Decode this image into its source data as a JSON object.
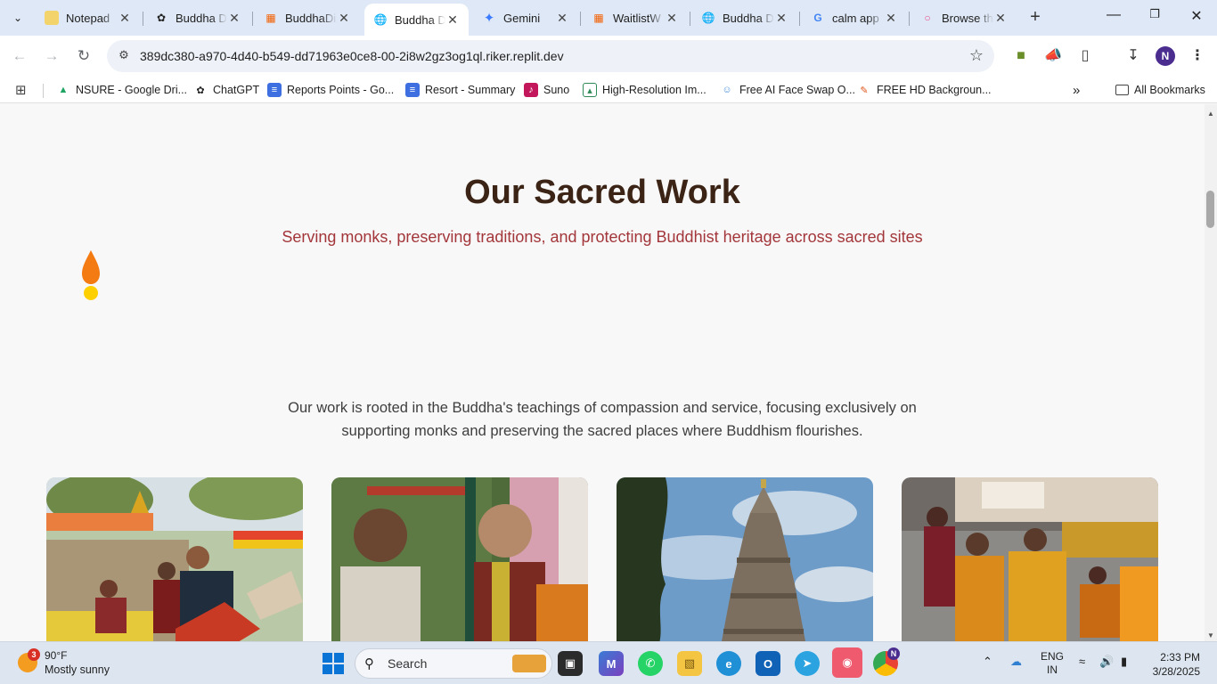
{
  "tabs": [
    {
      "title": "Notepad",
      "favicon": "notepad-icon",
      "color": "#f3d36b"
    },
    {
      "title": "Buddha D",
      "favicon": "openai-icon",
      "color": "#222222"
    },
    {
      "title": "BuddhaDi",
      "favicon": "replit-icon",
      "color": "#f26207"
    },
    {
      "title": "Buddha D",
      "favicon": "globe-icon",
      "color": "#5f6368"
    },
    {
      "title": "Gemini",
      "favicon": "gemini-icon",
      "color": "#3b7bff"
    },
    {
      "title": "WaitlistW",
      "favicon": "replit-icon",
      "color": "#f26207"
    },
    {
      "title": "Buddha D",
      "favicon": "globe-icon",
      "color": "#5f6368"
    },
    {
      "title": "calm app",
      "favicon": "google-icon",
      "color": "#4285f4"
    },
    {
      "title": "Browse th",
      "favicon": "dribbble-icon",
      "color": "#ea4c89"
    }
  ],
  "active_tab": 3,
  "address_bar": {
    "url": "389dc380-a970-4d40-b549-dd71963e0ce8-00-2i8w2gz3og1ql.riker.replit.dev"
  },
  "profile_initial": "N",
  "bookmarks": [
    {
      "label": "NSURE - Google Dri...",
      "icon": "google-drive-icon"
    },
    {
      "label": "ChatGPT",
      "icon": "openai-icon"
    },
    {
      "label": "Reports Points - Go...",
      "icon": "google-docs-icon"
    },
    {
      "label": "Resort - Summary",
      "icon": "google-docs-icon"
    },
    {
      "label": "Suno",
      "icon": "suno-icon"
    },
    {
      "label": "High-Resolution Im...",
      "icon": "image-icon"
    },
    {
      "label": "Free AI Face Swap O...",
      "icon": "face-icon"
    },
    {
      "label": "FREE HD Backgroun...",
      "icon": "brush-icon"
    }
  ],
  "all_bookmarks_label": "All Bookmarks",
  "page": {
    "title": "Our Sacred Work",
    "subtitle": "Serving monks, preserving traditions, and protecting Buddhist heritage across sacred sites",
    "description": "Our work is rooted in the Buddha's teachings of compassion and service, focusing exclusively on supporting monks and preserving the sacred places where Buddhism flourishes.",
    "colors": {
      "title": "#3b2415",
      "subtitle": "#a3363a",
      "flame": "#f47a12",
      "flame_base": "#ffd000"
    }
  },
  "taskbar": {
    "weather_temp": "90°F",
    "weather_desc": "Mostly sunny",
    "weather_badge": "3",
    "search_label": "Search",
    "lang_line1": "ENG",
    "lang_line2": "IN",
    "time": "2:33 PM",
    "date": "3/28/2025",
    "chrome_badge": "N"
  }
}
